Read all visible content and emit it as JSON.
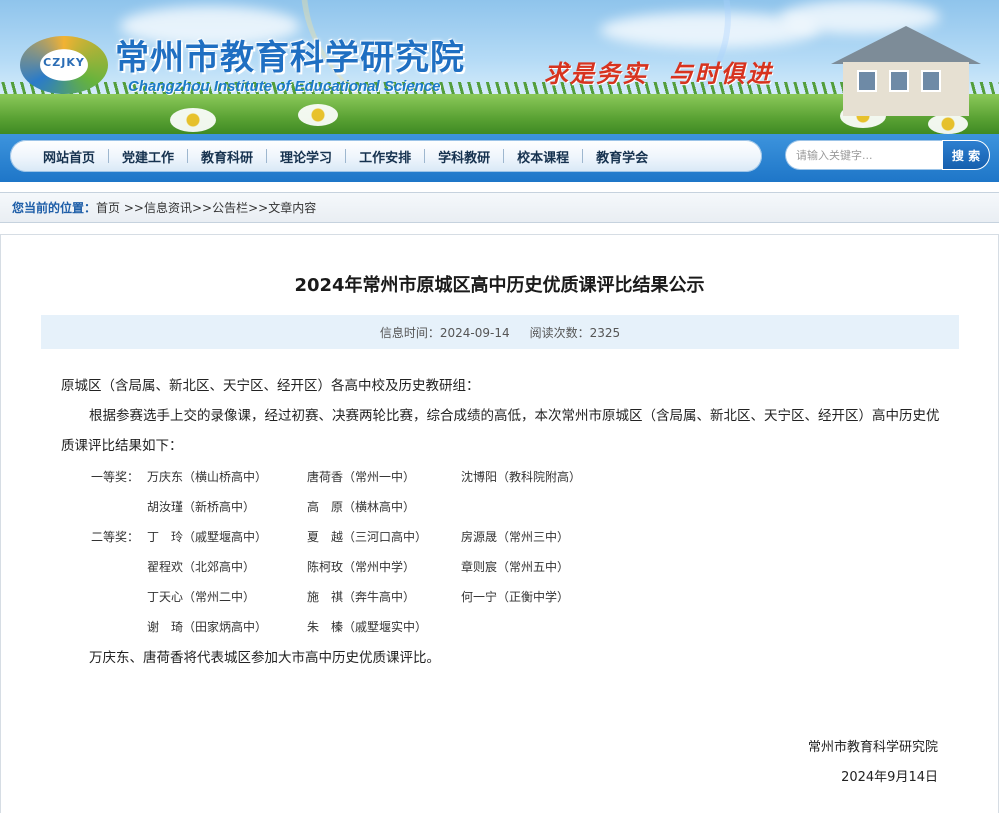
{
  "header": {
    "logo_abbr": "CZJKY",
    "institute_cn": "常州市教育科学研究院",
    "institute_en": "Changzhou Institute of Educational Science",
    "slogan": "求是务实  与时俱进"
  },
  "nav": {
    "items": [
      "网站首页",
      "党建工作",
      "教育科研",
      "理论学习",
      "工作安排",
      "学科教研",
      "校本课程",
      "教育学会"
    ],
    "search_placeholder": "请输入关键字...",
    "search_button": "搜 索"
  },
  "breadcrumb": {
    "label": "您当前的位置：",
    "items": [
      "首页",
      " >>信息资讯",
      ">>公告栏",
      ">>文章内容"
    ]
  },
  "article": {
    "title": "2024年常州市原城区高中历史优质课评比结果公示",
    "meta_time": "信息时间：2024-09-14",
    "meta_views": "阅读次数：2325",
    "salutation": "原城区（含局属、新北区、天宁区、经开区）各高中校及历史教研组：",
    "intro": "根据参赛选手上交的录像课，经过初赛、决赛两轮比赛，综合成绩的高低，本次常州市原城区（含局属、新北区、天宁区、经开区）高中历史优质课评比结果如下：",
    "awards": [
      [
        "一等奖：",
        "万庆东（横山桥高中）",
        "唐荷香（常州一中）",
        "沈博阳（教科院附高）"
      ],
      [
        "",
        "胡汝瑾（新桥高中）",
        "高　原（横林高中）",
        ""
      ],
      [
        "二等奖：",
        "丁　玲（戚墅堰高中）",
        "夏　越（三河口高中）",
        "房源晟（常州三中）"
      ],
      [
        "",
        "翟程欢（北郊高中）",
        "陈柯玫（常州中学）",
        "章则宸（常州五中）"
      ],
      [
        "",
        "丁天心（常州二中）",
        "施　祺（奔牛高中）",
        "何一宁（正衡中学）"
      ],
      [
        "",
        "谢　琦（田家炳高中）",
        "朱　榛（戚墅堰实中）",
        ""
      ]
    ],
    "closing": "万庆东、唐荷香将代表城区参加大市高中历史优质课评比。",
    "signature": "常州市教育科学研究院",
    "date": "2024年9月14日"
  }
}
